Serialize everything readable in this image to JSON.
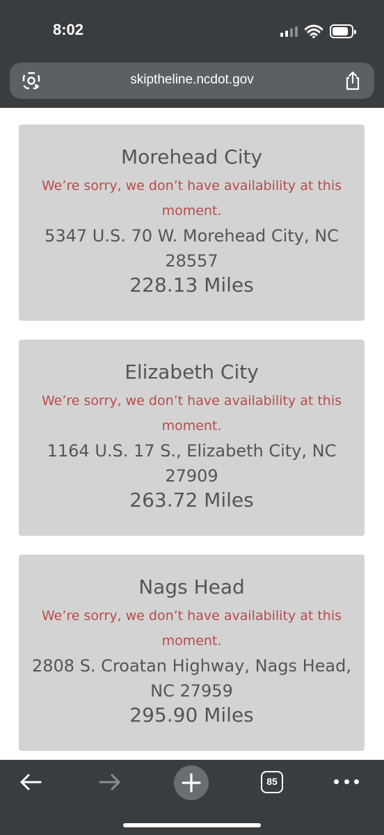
{
  "status_bar": {
    "time": "8:02"
  },
  "browser": {
    "url": "skiptheline.ncdot.gov",
    "tab_count": "85"
  },
  "locations": [
    {
      "name": "Morehead City",
      "message": "We’re sorry, we don’t have availability at this moment.",
      "address": "5347 U.S. 70 W. Morehead City, NC 28557",
      "distance": "228.13 Miles"
    },
    {
      "name": "Elizabeth City",
      "message": "We’re sorry, we don’t have availability at this moment.",
      "address": "1164 U.S. 17 S., Elizabeth City, NC 27909",
      "distance": "263.72 Miles"
    },
    {
      "name": "Nags Head",
      "message": "We’re sorry, we don’t have availability at this moment.",
      "address": "2808 S. Croatan Highway, Nags Head, NC 27959",
      "distance": "295.90 Miles"
    }
  ],
  "colors": {
    "chrome": "#3a3d40",
    "card": "#d3d3d3",
    "error_text": "#b84a4a",
    "body_text": "#555555"
  }
}
